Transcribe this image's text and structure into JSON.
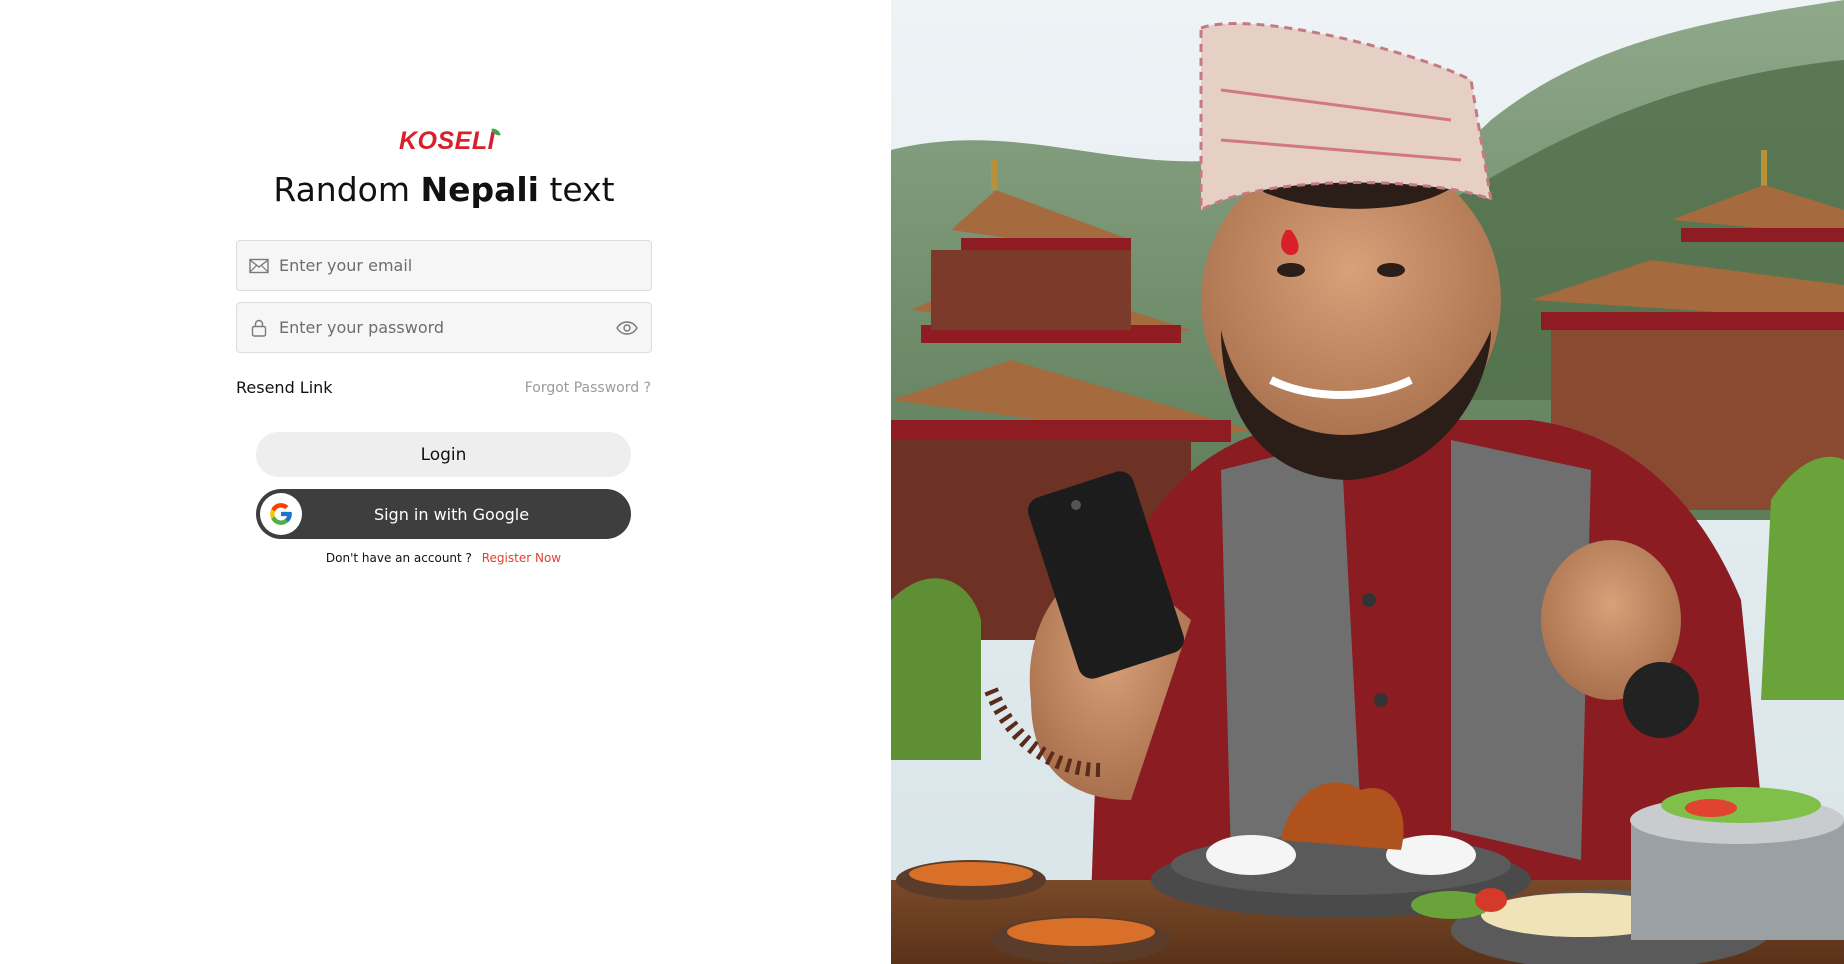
{
  "brand": {
    "logo_text": "KOSELI",
    "accent_color": "#d81f2a"
  },
  "heading": {
    "part1": "Random ",
    "part2": "Nepali",
    "part3": " text"
  },
  "email": {
    "placeholder": "Enter your email",
    "icon": "mail-icon"
  },
  "password": {
    "placeholder": "Enter your password",
    "icon": "lock-icon",
    "toggle_icon": "eye-icon"
  },
  "links": {
    "resend": "Resend Link",
    "forgot": "Forgot Password ?"
  },
  "buttons": {
    "login": "Login",
    "google": "Sign in with Google"
  },
  "register": {
    "prompt": "Don't have an account ?",
    "link": "Register Now",
    "link_color": "#e0412d"
  },
  "hero": {
    "description_icon": "hero-photo"
  }
}
